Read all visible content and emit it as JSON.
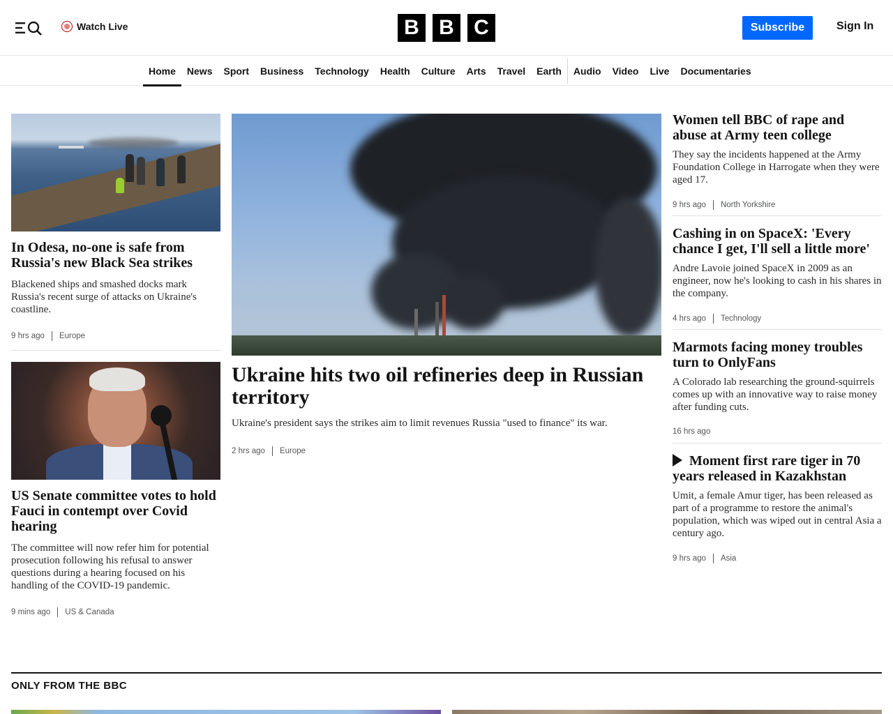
{
  "header": {
    "watch_live": "Watch Live",
    "logo_letters": [
      "B",
      "B",
      "C"
    ],
    "subscribe": "Subscribe",
    "sign_in": "Sign In"
  },
  "nav": {
    "items": [
      "Home",
      "News",
      "Sport",
      "Business",
      "Technology",
      "Health",
      "Culture",
      "Arts",
      "Travel",
      "Earth",
      "Audio",
      "Video",
      "Live",
      "Documentaries"
    ],
    "active": "Home"
  },
  "left_stories": [
    {
      "headline": "In Odesa, no-one is safe from Russia's new Black Sea strikes",
      "summary": "Blackened ships and smashed docks mark Russia's recent surge of attacks on Ukraine's coastline.",
      "time": "9 hrs ago",
      "section": "Europe"
    },
    {
      "headline": "US Senate committee votes to hold Fauci in contempt over Covid hearing",
      "summary": "The committee will now refer him for potential prosecution following his refusal to answer questions during a hearing focused on his handling of the COVID-19 pandemic.",
      "time": "9 mins ago",
      "section": "US & Canada"
    }
  ],
  "main_story": {
    "headline": "Ukraine hits two oil refineries deep in Russian territory",
    "summary": "Ukraine's president says the strikes aim to limit revenues Russia \"used to finance\" its war.",
    "time": "2 hrs ago",
    "section": "Europe"
  },
  "right_stories": [
    {
      "headline": "Women tell BBC of rape and abuse at Army teen college",
      "summary": "They say the incidents happened at the Army Foundation College in Harrogate when they were aged 17.",
      "time": "9 hrs ago",
      "section": "North Yorkshire"
    },
    {
      "headline": "Cashing in on SpaceX: 'Every chance I get, I'll sell a little more'",
      "summary": "Andre Lavoie joined SpaceX in 2009 as an engineer, now he's looking to cash in his shares in the company.",
      "time": "4 hrs ago",
      "section": "Technology"
    },
    {
      "headline": "Marmots facing money troubles turn to OnlyFans",
      "summary": "A Colorado lab researching the ground-squirrels comes up with an innovative way to raise money after funding cuts.",
      "time": "16 hrs ago",
      "section": ""
    },
    {
      "headline": "Moment first rare tiger in 70 years released in Kazakhstan",
      "summary": "Umit, a female Amur tiger, has been released as part of a programme to restore the animal's population, which was wiped out in central Asia a century ago.",
      "time": "9 hrs ago",
      "section": "Asia",
      "icon": "play-icon"
    }
  ],
  "only_from_bbc": {
    "title": "ONLY FROM THE BBC"
  }
}
